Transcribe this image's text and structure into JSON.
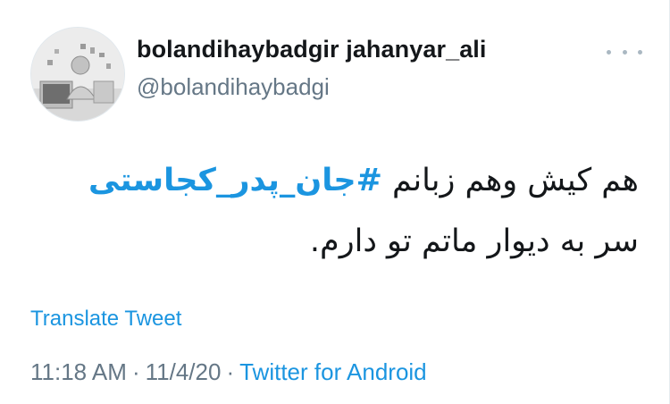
{
  "tweet": {
    "author": {
      "display_name": "bolandihaybadgir jahanyar_ali",
      "handle": "@bolandihaybadgi"
    },
    "body": {
      "line1_text_before": "هم کیش وهم زبانم ",
      "hashtag": "#جان_پدر_کجاستی",
      "line2": "سر به دیوار ماتم تو دارم."
    },
    "translate_label": "Translate Tweet",
    "time": "11:18 AM",
    "separator": "·",
    "date": "11/4/20",
    "source": "Twitter for Android"
  },
  "colors": {
    "link": "#1b95e0",
    "secondary_text": "#657786",
    "primary_text": "#14171a"
  },
  "icons": {
    "more": "more-horizontal-icon"
  }
}
